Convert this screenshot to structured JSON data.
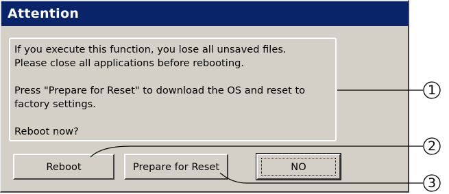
{
  "dialog": {
    "title": "Attention",
    "message_lines": [
      "If you execute this function, you lose all unsaved files.",
      "Please close all applications before rebooting.",
      "Press \"Prepare for Reset\" to download the OS and reset to",
      "factory settings.",
      "Reboot now?"
    ]
  },
  "buttons": {
    "reboot": "Reboot",
    "prepare_reset": "Prepare for Reset",
    "no": "NO"
  },
  "callouts": [
    "1",
    "2",
    "3"
  ],
  "colors": {
    "titlebar": "#0a246a",
    "dialog_bg": "#d4d0c8"
  }
}
